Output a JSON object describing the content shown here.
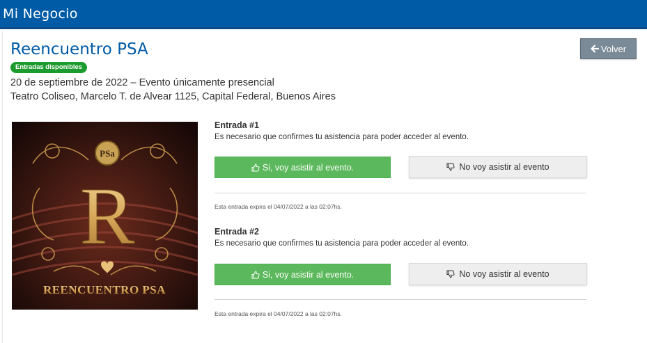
{
  "header": {
    "brand": "Mi Negocio"
  },
  "event": {
    "title": "Reencuentro PSA",
    "badge": "Entradas disponibles",
    "date_line": "20 de septiembre de 2022 – Evento únicamente presencial",
    "venue_line": "Teatro Coliseo, Marcelo T. de Alvear 1125, Capital Federal, Buenos Aires"
  },
  "back_button": {
    "label": "Volver",
    "icon": "arrow-left-icon"
  },
  "poster": {
    "logo_text": "PSa",
    "letter": "R",
    "caption": "REENCUENTRO PSA"
  },
  "entries": [
    {
      "title": "Entrada #1",
      "message": "Es necesario que confirmes tu asistencia para poder acceder al evento.",
      "yes_label": "Si, voy asistir al evento.",
      "no_label": "No voy asistir al evento",
      "expiry": "Esta entrada expira el 04/07/2022 a las 02:07hs."
    },
    {
      "title": "Entrada #2",
      "message": "Es necesario que confirmes tu asistencia para poder acceder al evento.",
      "yes_label": "Si, voy asistir al evento.",
      "no_label": "No voy asistir al evento",
      "expiry": "Esta entrada expira el 04/07/2022 a las 02:07hs."
    }
  ],
  "colors": {
    "header": "#005ba6",
    "title": "#005ba6",
    "badge": "#1c9b2e",
    "yes_button": "#5cb85c",
    "no_button": "#eeeeee",
    "back_button": "#7a8a96"
  }
}
